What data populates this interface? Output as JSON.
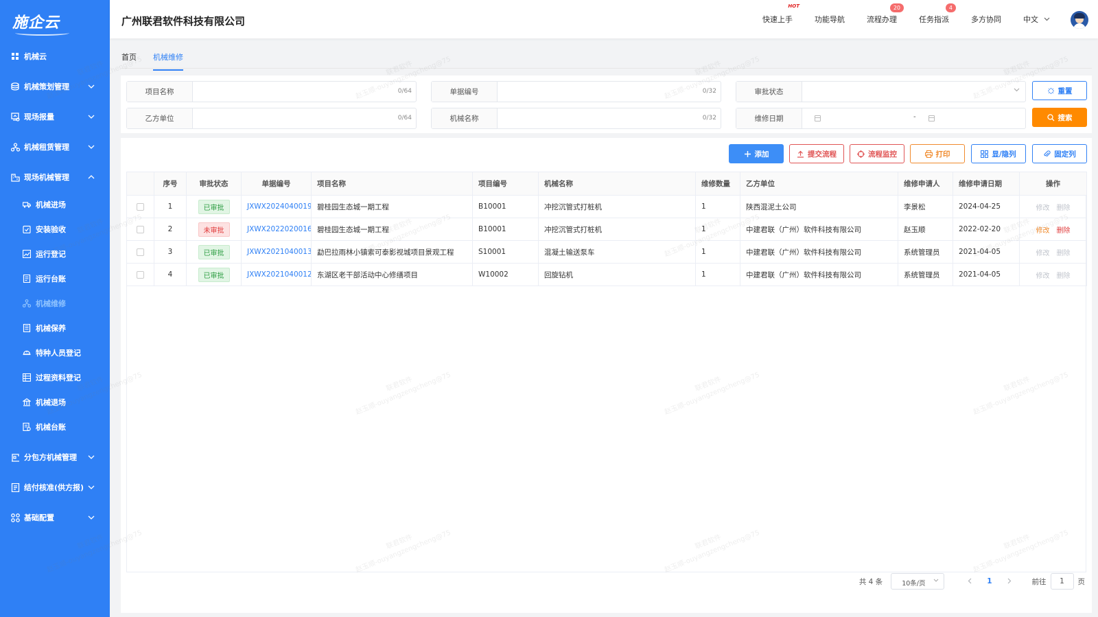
{
  "app": {
    "logo_text": "施企云",
    "company_name": "广州联君软件科技有限公司"
  },
  "sidebar": {
    "items": [
      {
        "label": "机械云"
      },
      {
        "label": "机械策划管理"
      },
      {
        "label": "现场报量"
      },
      {
        "label": "机械租赁管理"
      },
      {
        "label": "现场机械管理"
      },
      {
        "label": "分包方机械管理"
      },
      {
        "label": "结付核准(供方报)"
      },
      {
        "label": "基础配置"
      }
    ],
    "sub_items": [
      {
        "label": "机械进场"
      },
      {
        "label": "安装验收"
      },
      {
        "label": "运行登记"
      },
      {
        "label": "运行台账"
      },
      {
        "label": "机械维修"
      },
      {
        "label": "机械保养"
      },
      {
        "label": "特种人员登记"
      },
      {
        "label": "过程资料登记"
      },
      {
        "label": "机械退场"
      },
      {
        "label": "机械台账"
      }
    ]
  },
  "header": {
    "nav": [
      {
        "label": "快速上手",
        "hot": "HOT"
      },
      {
        "label": "功能导航"
      },
      {
        "label": "流程办理",
        "badge": "20"
      },
      {
        "label": "任务指派",
        "badge": "4"
      },
      {
        "label": "多方协同"
      }
    ],
    "language": "中文"
  },
  "tabs": [
    {
      "label": "首页"
    },
    {
      "label": "机械维修"
    }
  ],
  "search": {
    "project_name": {
      "label": "项目名称",
      "count": "0/64"
    },
    "doc_no": {
      "label": "单据编号",
      "count": "0/32"
    },
    "approval_status": {
      "label": "审批状态"
    },
    "party_b": {
      "label": "乙方单位",
      "count": "0/64"
    },
    "machine_name": {
      "label": "机械名称",
      "count": "0/32"
    },
    "repair_date": {
      "label": "维修日期",
      "separator": "-"
    },
    "reset_label": "重置",
    "search_label": "搜索"
  },
  "toolbar": {
    "add": "添加",
    "submit_flow": "提交流程",
    "flow_monitor": "流程监控",
    "print": "打印",
    "show_hide_cols": "显/隐列",
    "fix_cols": "固定列"
  },
  "table": {
    "headers": [
      "序号",
      "审批状态",
      "单据编号",
      "项目名称",
      "项目编号",
      "机械名称",
      "维修数量",
      "乙方单位",
      "维修申请人",
      "维修申请日期",
      "操作"
    ],
    "rows": [
      {
        "no": "1",
        "status": "已审批",
        "approved": true,
        "doc_no": "JXWX2024040019",
        "project": "碧桂园生态城一期工程",
        "project_no": "B10001",
        "machine": "冲挖沉管式打桩机",
        "qty": "1",
        "party_b": "陕西混泥土公司",
        "applicant": "李景松",
        "date": "2024-04-25",
        "edit": "修改",
        "del": "删除"
      },
      {
        "no": "2",
        "status": "未审批",
        "approved": false,
        "doc_no": "JXWX2022020016",
        "project": "碧桂园生态城一期工程",
        "project_no": "B10001",
        "machine": "冲挖沉管式打桩机",
        "qty": "1",
        "party_b": "中建君联（广州）软件科技有限公司",
        "applicant": "赵玉顺",
        "date": "2022-02-20",
        "edit": "修改",
        "del": "删除"
      },
      {
        "no": "3",
        "status": "已审批",
        "approved": true,
        "doc_no": "JXWX2021040013",
        "project": "勐巴拉雨林小镇索可泰影视城项目景观工程",
        "project_no": "S10001",
        "machine": "混凝土输送泵车",
        "qty": "1",
        "party_b": "中建君联（广州）软件科技有限公司",
        "applicant": "系统管理员",
        "date": "2021-04-05",
        "edit": "修改",
        "del": "删除"
      },
      {
        "no": "4",
        "status": "已审批",
        "approved": true,
        "doc_no": "JXWX2021040012",
        "project": "东湖区老干部活动中心修缮项目",
        "project_no": "W10002",
        "machine": "回旋钻机",
        "qty": "1",
        "party_b": "中建君联（广州）软件科技有限公司",
        "applicant": "系统管理员",
        "date": "2021-04-05",
        "edit": "修改",
        "del": "删除"
      }
    ]
  },
  "pagination": {
    "total": "共 4 条",
    "page_size": "10条/页",
    "current": "1",
    "goto_prefix": "前往",
    "goto_value": "1",
    "goto_suffix": "页"
  },
  "watermark": {
    "line1": "联君软件",
    "line2": "赵玉顺-ouyangzengcheng@75"
  },
  "colors": {
    "sidebar": "#2f80f5",
    "primary": "#2f80f5",
    "search_button": "#ff8a00",
    "approved": "#2f9e44",
    "unapproved": "#e03b3b"
  }
}
